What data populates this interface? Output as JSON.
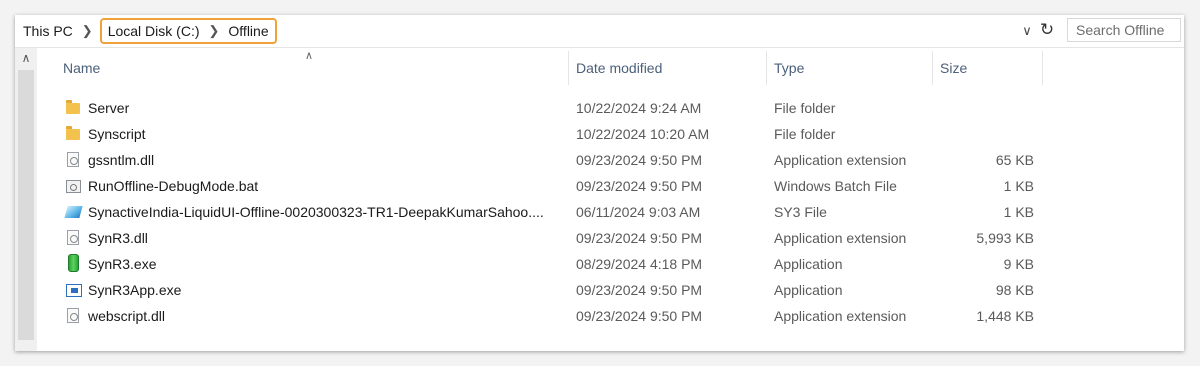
{
  "breadcrumb": {
    "root": "This PC",
    "drive": "Local Disk (C:)",
    "folder": "Offline"
  },
  "search": {
    "placeholder": "Search Offline"
  },
  "columns": {
    "name": "Name",
    "date": "Date modified",
    "type": "Type",
    "size": "Size"
  },
  "files": [
    {
      "name": "Server",
      "date": "10/22/2024 9:24 AM",
      "type": "File folder",
      "size": "",
      "icon": "folder-icon"
    },
    {
      "name": "Synscript",
      "date": "10/22/2024 10:20 AM",
      "type": "File folder",
      "size": "",
      "icon": "folder-icon"
    },
    {
      "name": "gssntlm.dll",
      "date": "09/23/2024 9:50 PM",
      "type": "Application extension",
      "size": "65 KB",
      "icon": "dll-file-icon"
    },
    {
      "name": "RunOffline-DebugMode.bat",
      "date": "09/23/2024 9:50 PM",
      "type": "Windows Batch File",
      "size": "1 KB",
      "icon": "batch-file-icon"
    },
    {
      "name": "SynactiveIndia-LiquidUI-Offline-0020300323-TR1-DeepakKumarSahoo....",
      "date": "06/11/2024 9:03 AM",
      "type": "SY3 File",
      "size": "1 KB",
      "icon": "sy3-file-icon"
    },
    {
      "name": "SynR3.dll",
      "date": "09/23/2024 9:50 PM",
      "type": "Application extension",
      "size": "5,993 KB",
      "icon": "dll-file-icon"
    },
    {
      "name": "SynR3.exe",
      "date": "08/29/2024 4:18 PM",
      "type": "Application",
      "size": "9 KB",
      "icon": "green-exe-icon"
    },
    {
      "name": "SynR3App.exe",
      "date": "09/23/2024 9:50 PM",
      "type": "Application",
      "size": "98 KB",
      "icon": "app-window-icon"
    },
    {
      "name": "webscript.dll",
      "date": "09/23/2024 9:50 PM",
      "type": "Application extension",
      "size": "1,448 KB",
      "icon": "dll-file-icon"
    }
  ],
  "colors": {
    "highlight_border": "#f0a23a",
    "header_text": "#4c607a",
    "folder": "#f2c14e"
  }
}
